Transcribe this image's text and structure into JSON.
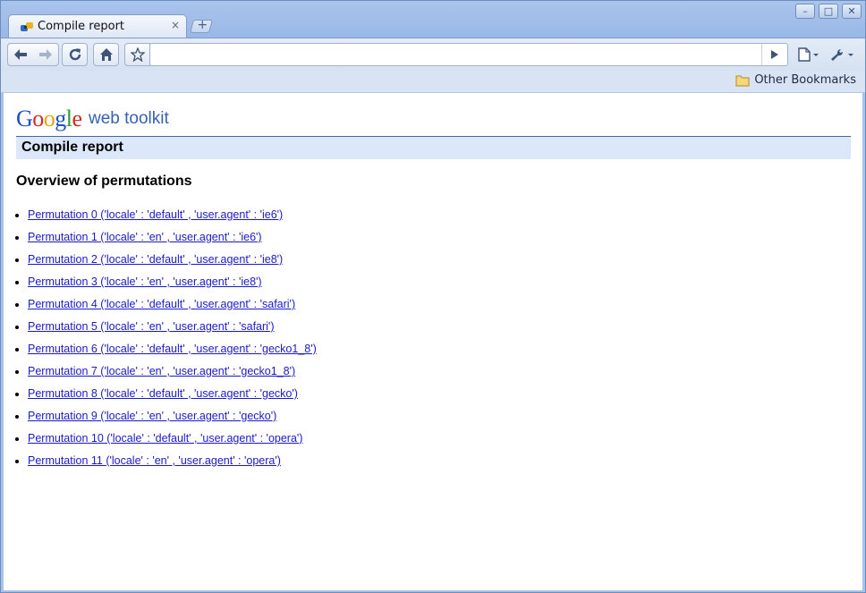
{
  "window": {
    "tab_title": "Compile report",
    "tab_close": "×",
    "new_tab": "+",
    "controls": {
      "minimize": "–",
      "maximize": "□",
      "close": "✕"
    }
  },
  "toolbar": {
    "address_value": "",
    "icons": [
      "back-icon",
      "forward-icon",
      "reload-icon",
      "home-icon",
      "star-icon",
      "go-icon",
      "page-menu-icon",
      "wrench-icon"
    ]
  },
  "bookmarks": {
    "other_label": "Other Bookmarks"
  },
  "page": {
    "logo_word": "Google",
    "logo_sub": "web toolkit",
    "header": "Compile report",
    "section_title": "Overview of permutations",
    "permutations": [
      "Permutation 0 ('locale' : 'default' , 'user.agent' : 'ie6')",
      "Permutation 1 ('locale' : 'en' , 'user.agent' : 'ie6')",
      "Permutation 2 ('locale' : 'default' , 'user.agent' : 'ie8')",
      "Permutation 3 ('locale' : 'en' , 'user.agent' : 'ie8')",
      "Permutation 4 ('locale' : 'default' , 'user.agent' : 'safari')",
      "Permutation 5 ('locale' : 'en' , 'user.agent' : 'safari')",
      "Permutation 6 ('locale' : 'default' , 'user.agent' : 'gecko1_8')",
      "Permutation 7 ('locale' : 'en' , 'user.agent' : 'gecko1_8')",
      "Permutation 8 ('locale' : 'default' , 'user.agent' : 'gecko')",
      "Permutation 9 ('locale' : 'en' , 'user.agent' : 'gecko')",
      "Permutation 10 ('locale' : 'default' , 'user.agent' : 'opera')",
      "Permutation 11 ('locale' : 'en' , 'user.agent' : 'opera')"
    ]
  },
  "colors": {
    "link": "#1a1acb",
    "header_bg": "#dce8fa",
    "header_rule": "#3f66a8",
    "chrome_frame": "#a8c3ea"
  }
}
